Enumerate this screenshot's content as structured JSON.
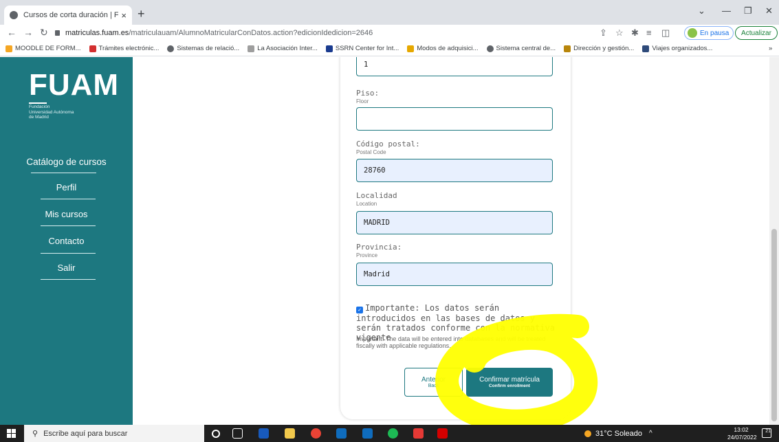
{
  "browser": {
    "tab_title": "Cursos de corta duración | FUAM",
    "tab_close": "×",
    "new_tab": "+",
    "url_host": "matriculas.fuam.es",
    "url_path": "/matriculauam/AlumnoMatricularConDatos.action?edicionIdedicion=2646",
    "profile_label": "En pausa",
    "update_label": "Actualizar",
    "bookmarks": [
      {
        "label": "MOODLE DE FORM...",
        "color": "#f5a623"
      },
      {
        "label": "Trámites electrónic...",
        "color": "#d32f2f"
      },
      {
        "label": "Sistemas de relació...",
        "color": "#5f6368"
      },
      {
        "label": "La Asociación Inter...",
        "color": "#9e9e9e"
      },
      {
        "label": "SSRN Center for Int...",
        "color": "#1a3b8f"
      },
      {
        "label": "Modos de adquisici...",
        "color": "#e6a800"
      },
      {
        "label": "Sistema central de...",
        "color": "#5f6368"
      },
      {
        "label": "Dirección y gestión...",
        "color": "#b8860b"
      },
      {
        "label": "Viajes organizados...",
        "color": "#2e4a7a"
      }
    ],
    "bookmarks_more": "»"
  },
  "sidebar": {
    "logo_text": "FUAM",
    "logo_sub1": "Fundación",
    "logo_sub2": "Universidad Autónoma",
    "logo_sub3": "de Madrid",
    "items": [
      {
        "label": "Catálogo de cursos"
      },
      {
        "label": "Perfil"
      },
      {
        "label": "Mis cursos"
      },
      {
        "label": "Contacto"
      },
      {
        "label": "Salir"
      }
    ]
  },
  "form": {
    "number_value": "1",
    "piso_label": "Piso:",
    "piso_sub": "Floor",
    "piso_value": "",
    "cp_label": "Código postal:",
    "cp_sub": "Postal Code",
    "cp_value": "28760",
    "localidad_label": "Localidad",
    "localidad_sub": "Location",
    "localidad_value": "MADRID",
    "provincia_label": "Provincia:",
    "provincia_sub": "Province",
    "provincia_value": "Madrid",
    "consent_es": "Importante: Los datos serán introducidos en las bases de datos y serán tratados conforme con la normativa vigente",
    "consent_en": "Important: The data will be entered into databases and will be treated fiscally with applicable regulations.",
    "back_label": "Anterior",
    "back_sub": "Back",
    "confirm_label": "Confirmar matrícula",
    "confirm_sub": "Confirm enrollment"
  },
  "taskbar": {
    "search_placeholder": "Escribe aquí para buscar",
    "weather": "31°C Soleado",
    "time": "13:02",
    "date": "24/07/2022",
    "notif_count": "21"
  },
  "colors": {
    "brand_teal": "#1d7880",
    "highlight": "#ffff00"
  }
}
